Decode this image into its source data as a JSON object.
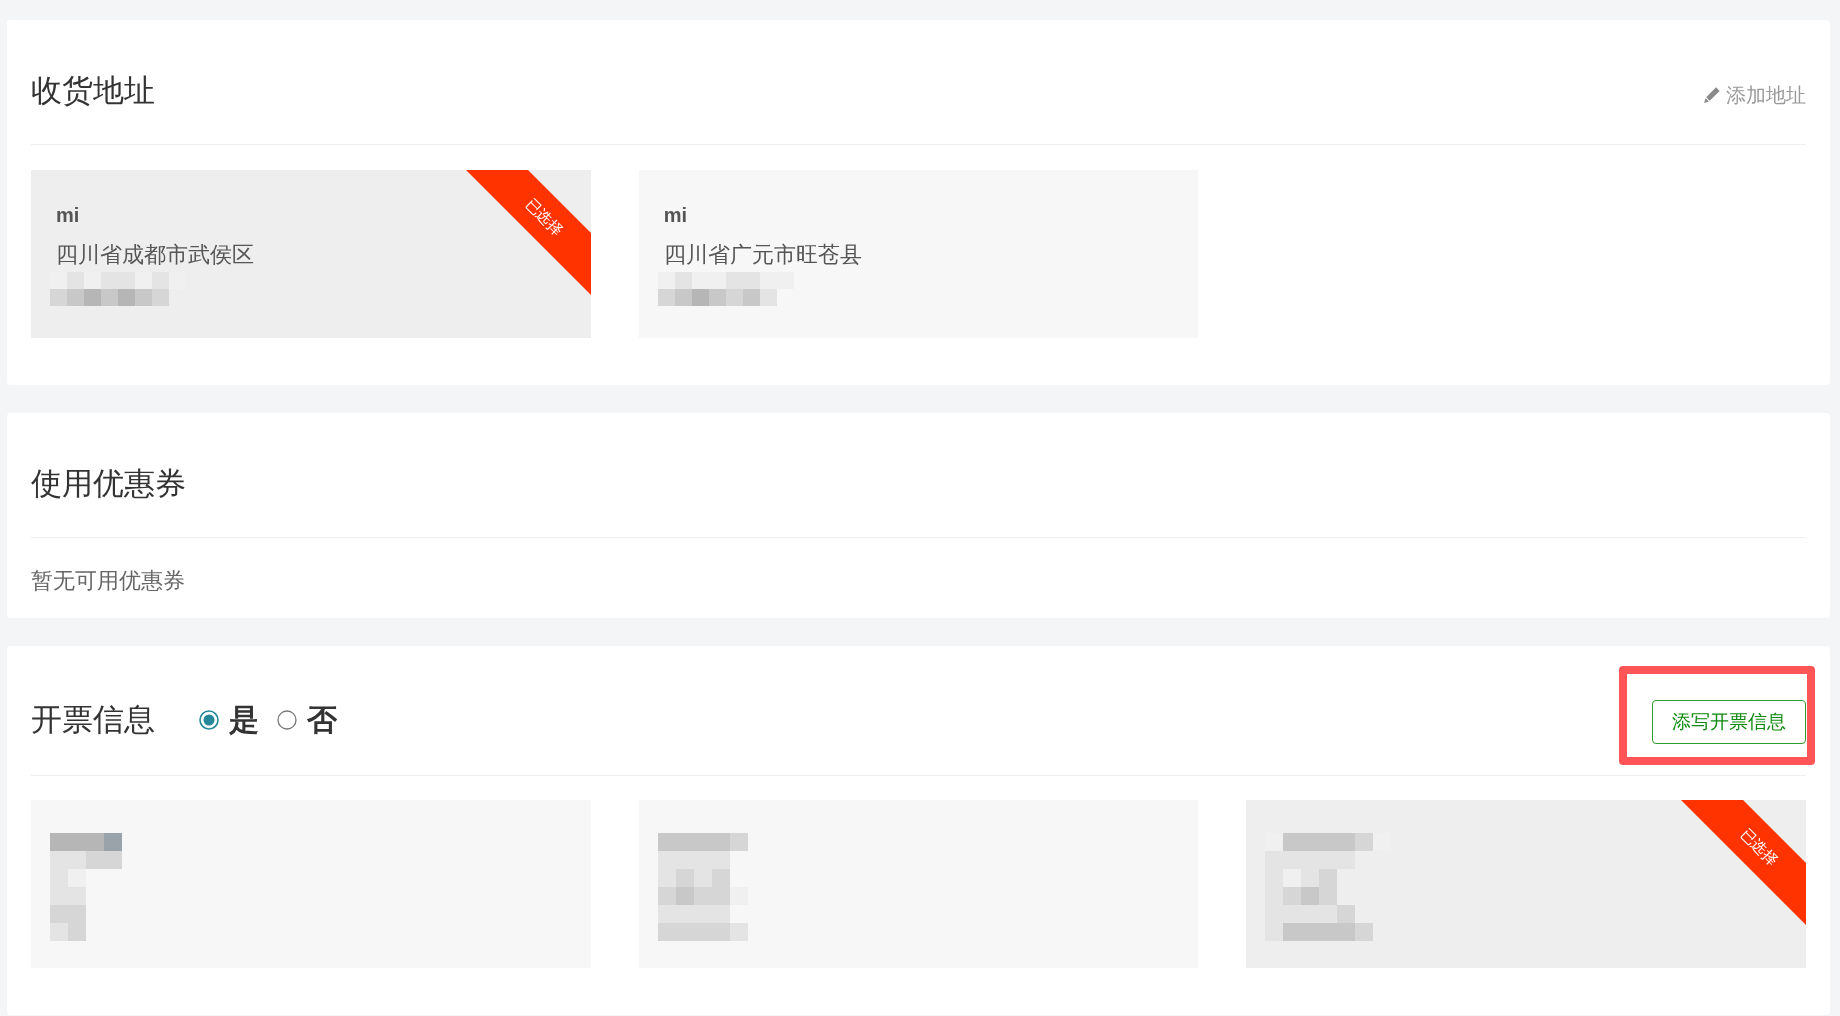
{
  "shipping_address": {
    "title": "收货地址",
    "add_link": "添加地址",
    "cards": [
      {
        "name": "mi",
        "address": "四川省成都市武侯区",
        "selected": true,
        "ribbon_label": "已选择"
      },
      {
        "name": "mi",
        "address": "四川省广元市旺苍县",
        "selected": false
      }
    ]
  },
  "coupon": {
    "title": "使用优惠券",
    "empty_text": "暂无可用优惠券"
  },
  "invoice": {
    "title": "开票信息",
    "options": [
      {
        "label": "是",
        "selected": true
      },
      {
        "label": "否",
        "selected": false
      }
    ],
    "fill_button": "添写开票信息",
    "cards": [
      {
        "selected": false
      },
      {
        "selected": false
      },
      {
        "selected": true,
        "ribbon_label": "已选择"
      }
    ]
  }
}
